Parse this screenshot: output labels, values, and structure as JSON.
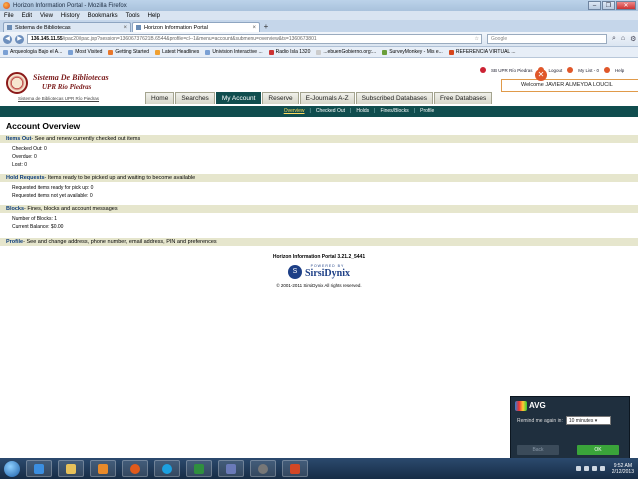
{
  "window": {
    "title": "Horizon Information Portal - Mozilla Firefox",
    "controls": [
      "–",
      "❐",
      "✕"
    ]
  },
  "menu": [
    "File",
    "Edit",
    "View",
    "History",
    "Bookmarks",
    "Tools",
    "Help"
  ],
  "tabs": [
    {
      "label": "Sistema de Bibliotecas",
      "close": "×"
    },
    {
      "label": "Horizon Information Portal",
      "close": "×"
    }
  ],
  "newtab": "+",
  "nav": {
    "back": "◀",
    "forward": "▶",
    "url_host": "136.145.11.55",
    "url_path": "/ipac20/ipac.jsp?session=13606737621B.6544&profile=cl--1&menu=account&submenu=overview&ts=1360673801",
    "star": "☆",
    "search_placeholder": "Google"
  },
  "bookmarks": [
    "Arqueología Bajo el A...",
    "Most Visited",
    "Getting Started",
    "Latest Headlines",
    "Univision Interactive ...",
    "Radio Isla 1320",
    "...ebuenGobierno.org:...",
    "SurveyMonkey - Mis e...",
    "REFERENCIA VIRTUAL ..."
  ],
  "header": {
    "logo_line1": "Sistema De Bibliotecas",
    "logo_line2": "UPR Río Piedras",
    "logo_link": "Sistema de Bibliotecas UPR Río Piedras",
    "toplinks": [
      "Logout",
      "My List - 0",
      "Help"
    ],
    "toplink_first": "SB UPR Río Piedras",
    "notif_close": "✕",
    "welcome": "Welcome JAVIER ALMEYDA LOUCIL"
  },
  "navtabs": [
    "Home",
    "Searches",
    "My Account",
    "Reserve",
    "E-Journals A-Z",
    "Subscribed Databases",
    "Free Databases"
  ],
  "subnav": [
    "Overview",
    "Checked Out",
    "Holds",
    "Fines/Blocks",
    "Profile"
  ],
  "subnav_sep": "|",
  "content": {
    "title": "Account Overview",
    "items_out": {
      "link": "Items Out",
      "desc": "- See and renew currently checked out items",
      "lines": [
        "Checked Out: 0",
        "Overdue: 0",
        "Lost: 0"
      ]
    },
    "holds": {
      "link": "Hold Requests",
      "desc": "- Items ready to be picked up and waiting to become available",
      "lines": [
        "Requested items ready for pick up: 0",
        "Requested items not yet available: 0"
      ]
    },
    "blocks": {
      "link": "Blocks",
      "desc": "- Fines, blocks and account messages",
      "lines": [
        "Number of Blocks: 1",
        "Current Balance: $0.00"
      ]
    },
    "profile": {
      "link": "Profile",
      "desc": "- See and change address, phone number, email address, PIN and preferences"
    }
  },
  "footer": {
    "portal": "Horizon Information Portal 3.21.2_5441",
    "powered": "POWERED BY",
    "brand": "SirsiDynix",
    "brand_mark": "S",
    "copyright": "© 2001-2011 SirsiDynix All rights reserved."
  },
  "avg": {
    "title": "AVG",
    "remind_label": "Remind me again in:",
    "remind_value": "10 minutes  ▾",
    "back": "Back",
    "ok": "OK"
  },
  "taskbar": {
    "time": "9:52 AM",
    "date": "2/12/2013"
  }
}
